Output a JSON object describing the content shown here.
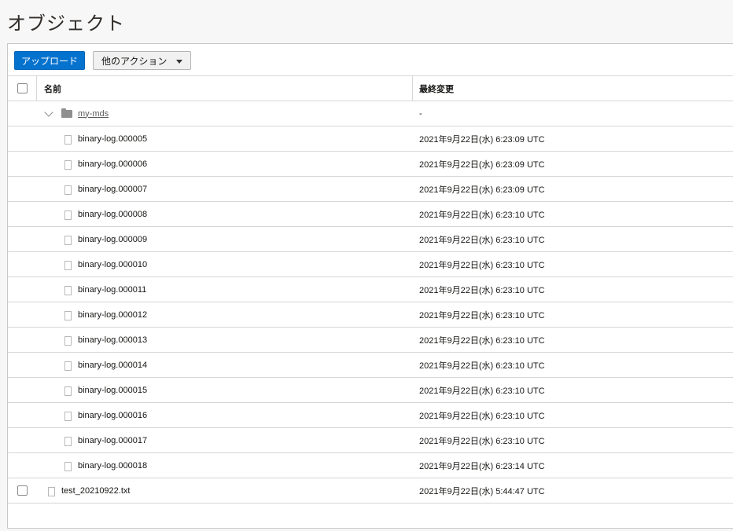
{
  "page": {
    "title": "オブジェクト"
  },
  "toolbar": {
    "upload_label": "アップロード",
    "more_actions_label": "他のアクション"
  },
  "table": {
    "headers": {
      "name": "名前",
      "modified": "最終変更"
    },
    "folder": {
      "name": "my-mds",
      "modified": "-"
    },
    "children": [
      {
        "name": "binary-log.000005",
        "modified": "2021年9月22日(水) 6:23:09 UTC"
      },
      {
        "name": "binary-log.000006",
        "modified": "2021年9月22日(水) 6:23:09 UTC"
      },
      {
        "name": "binary-log.000007",
        "modified": "2021年9月22日(水) 6:23:09 UTC"
      },
      {
        "name": "binary-log.000008",
        "modified": "2021年9月22日(水) 6:23:10 UTC"
      },
      {
        "name": "binary-log.000009",
        "modified": "2021年9月22日(水) 6:23:10 UTC"
      },
      {
        "name": "binary-log.000010",
        "modified": "2021年9月22日(水) 6:23:10 UTC"
      },
      {
        "name": "binary-log.000011",
        "modified": "2021年9月22日(水) 6:23:10 UTC"
      },
      {
        "name": "binary-log.000012",
        "modified": "2021年9月22日(水) 6:23:10 UTC"
      },
      {
        "name": "binary-log.000013",
        "modified": "2021年9月22日(水) 6:23:10 UTC"
      },
      {
        "name": "binary-log.000014",
        "modified": "2021年9月22日(水) 6:23:10 UTC"
      },
      {
        "name": "binary-log.000015",
        "modified": "2021年9月22日(水) 6:23:10 UTC"
      },
      {
        "name": "binary-log.000016",
        "modified": "2021年9月22日(水) 6:23:10 UTC"
      },
      {
        "name": "binary-log.000017",
        "modified": "2021年9月22日(水) 6:23:10 UTC"
      },
      {
        "name": "binary-log.000018",
        "modified": "2021年9月22日(水) 6:23:14 UTC"
      }
    ],
    "toplevel": [
      {
        "name": "test_20210922.txt",
        "modified": "2021年9月22日(水) 5:44:47 UTC"
      }
    ]
  },
  "icons": {
    "folder": "folder-icon",
    "file": "file-icon",
    "expand": "chevron-down-icon",
    "dropdown": "caret-down-icon"
  },
  "colors": {
    "primary": "#0572ce",
    "border": "#d6d6d6"
  }
}
